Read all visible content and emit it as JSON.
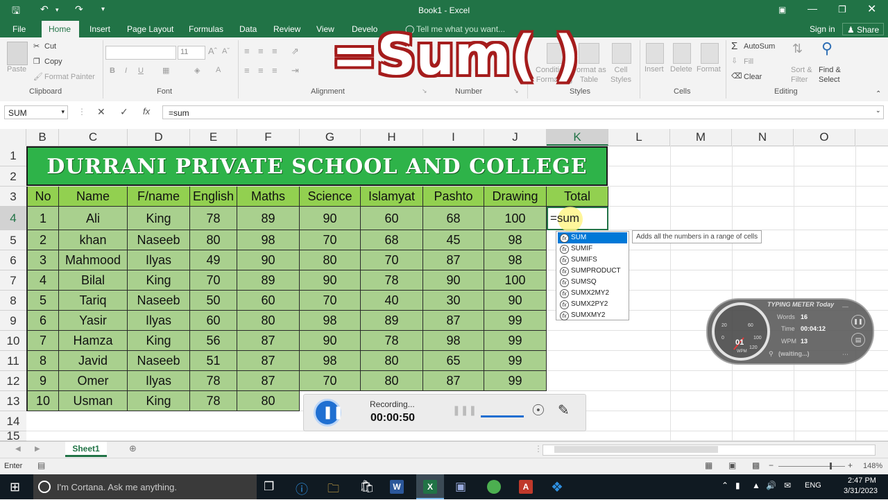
{
  "window": {
    "title": "Book1 - Excel"
  },
  "title_bar": {
    "signin": "Sign in",
    "share": "Share"
  },
  "ribbon": {
    "tabs": [
      "File",
      "Home",
      "Insert",
      "Page Layout",
      "Formulas",
      "Data",
      "Review",
      "View",
      "Develo"
    ],
    "tell_me": "Tell me what you want...",
    "clipboard": {
      "paste": "Paste",
      "cut": "Cut",
      "copy": "Copy",
      "format_painter": "Format Painter",
      "group": "Clipboard"
    },
    "font": {
      "size": "11",
      "bold": "B",
      "italic": "I",
      "underline": "U",
      "group": "Font"
    },
    "alignment": {
      "group": "Alignment"
    },
    "number": {
      "group": "Number"
    },
    "styles": {
      "conditional": "Conditional\nFormatting",
      "format_table": "Format as\nTable",
      "cell_styles": "Cell\nStyles",
      "group": "Styles"
    },
    "cells": {
      "insert": "Insert",
      "delete": "Delete",
      "format": "Format",
      "group": "Cells"
    },
    "editing": {
      "autosum": "AutoSum",
      "fill": "Fill",
      "clear": "Clear",
      "sort": "Sort &\nFilter",
      "find": "Find &\nSelect",
      "group": "Editing"
    }
  },
  "formula_bar": {
    "name_box": "SUM",
    "formula": "=sum"
  },
  "overlay_title": "=Sum( )",
  "columns": [
    "B",
    "C",
    "D",
    "E",
    "F",
    "G",
    "H",
    "I",
    "J",
    "K",
    "L",
    "M",
    "N",
    "O"
  ],
  "rows": [
    "1",
    "2",
    "3",
    "4",
    "5",
    "6",
    "7",
    "8",
    "9",
    "10",
    "11",
    "12",
    "13",
    "14",
    "15"
  ],
  "sheet": {
    "banner": "DURRANI PRIVATE SCHOOL AND COLLEGE",
    "headers": [
      "No",
      "Name",
      "F/name",
      "English",
      "Maths",
      "Science",
      "Islamyat",
      "Pashto",
      "Drawing",
      "Total"
    ],
    "records": [
      [
        "1",
        "Ali",
        "King",
        "78",
        "89",
        "90",
        "60",
        "68",
        "100"
      ],
      [
        "2",
        "khan",
        "Naseeb",
        "80",
        "98",
        "70",
        "68",
        "45",
        "98"
      ],
      [
        "3",
        "Mahmood",
        "Ilyas",
        "49",
        "90",
        "80",
        "70",
        "87",
        "98"
      ],
      [
        "4",
        "Bilal",
        "King",
        "70",
        "89",
        "90",
        "78",
        "90",
        "100"
      ],
      [
        "5",
        "Tariq",
        "Naseeb",
        "50",
        "60",
        "70",
        "40",
        "30",
        "90"
      ],
      [
        "6",
        "Yasir",
        "Ilyas",
        "60",
        "80",
        "98",
        "89",
        "87",
        "99"
      ],
      [
        "7",
        "Hamza",
        "King",
        "56",
        "87",
        "90",
        "78",
        "98",
        "99"
      ],
      [
        "8",
        "Javid",
        "Naseeb",
        "51",
        "87",
        "98",
        "80",
        "65",
        "99"
      ],
      [
        "9",
        "Omer",
        "Ilyas",
        "78",
        "87",
        "70",
        "80",
        "87",
        "99"
      ],
      [
        "10",
        "Usman",
        "King",
        "78",
        "80",
        "",
        "",
        "",
        ""
      ]
    ],
    "editing_cell": "=sum"
  },
  "autocomplete": {
    "items": [
      "SUM",
      "SUMIF",
      "SUMIFS",
      "SUMPRODUCT",
      "SUMSQ",
      "SUMX2MY2",
      "SUMX2PY2",
      "SUMXMY2"
    ],
    "tooltip": "Adds all the numbers in a range of cells"
  },
  "recorder": {
    "status": "Recording...",
    "time": "00:00:50"
  },
  "typing_meter": {
    "title": "TYPING METER Today",
    "words_label": "Words",
    "words": "16",
    "time_label": "Time",
    "time": "00:04:12",
    "wpm_label": "WPM",
    "wpm": "13",
    "gauge": "01",
    "gauge_unit": "WPM",
    "waiting": "(waiting...)",
    "gauge_ticks": [
      "20",
      "60",
      "100",
      "0",
      "120"
    ]
  },
  "sheet_tabs": {
    "active": "Sheet1"
  },
  "status_bar": {
    "mode": "Enter",
    "zoom": "148%"
  },
  "taskbar": {
    "search": "I'm Cortana. Ask me anything.",
    "lang": "ENG",
    "time": "2:47 PM",
    "date": "3/31/2023"
  }
}
